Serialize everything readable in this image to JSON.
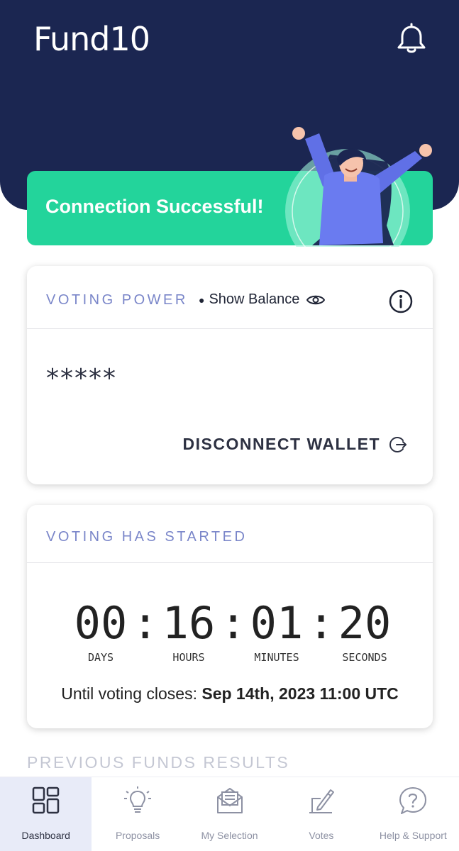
{
  "header": {
    "title": "Fund10",
    "bell_icon": "bell-icon"
  },
  "banner": {
    "text": "Connection Successful!",
    "illustration": "celebrating-woman-illustration",
    "color": "#23d49b"
  },
  "voting_power": {
    "label": "VOTING POWER",
    "show_balance": "Show Balance",
    "balance_masked": "*****",
    "disconnect_label": "DISCONNECT WALLET"
  },
  "voting_timer": {
    "label": "VOTING HAS STARTED",
    "days": "00",
    "hours": "16",
    "minutes": "01",
    "seconds": "20",
    "days_label": "DAYS",
    "hours_label": "HOURS",
    "minutes_label": "MINUTES",
    "seconds_label": "SECONDS",
    "until_prefix": "Until voting closes:",
    "until_date": "Sep 14th, 2023 11:00 UTC"
  },
  "previous_funds": {
    "title": "PREVIOUS FUNDS RESULTS"
  },
  "nav": [
    {
      "label": "Dashboard",
      "icon": "dashboard-icon",
      "active": true
    },
    {
      "label": "Proposals",
      "icon": "lightbulb-icon"
    },
    {
      "label": "My Selection",
      "icon": "envelope-icon"
    },
    {
      "label": "Votes",
      "icon": "vote-pen-icon"
    },
    {
      "label": "Help & Support",
      "icon": "help-bubble-icon"
    }
  ],
  "colors": {
    "header": "#1b2651",
    "accent": "#7a86c9",
    "success": "#23d49b"
  }
}
